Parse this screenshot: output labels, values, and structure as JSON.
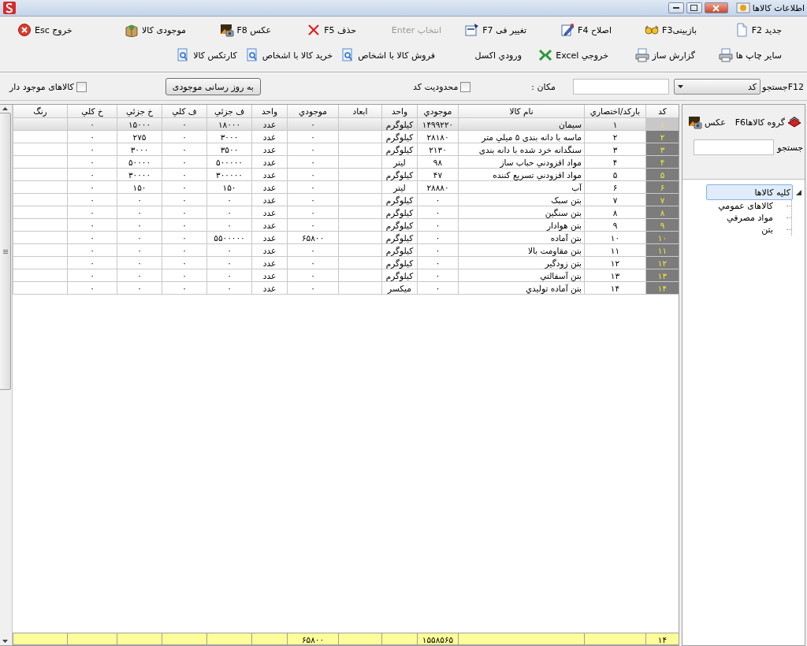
{
  "window": {
    "title": "اطلاعات کالاها"
  },
  "toolbar": {
    "row_1": [
      {
        "label": "جدید F2",
        "disabled": false
      },
      {
        "label": "بازبینیF3",
        "disabled": false
      },
      {
        "label": "اصلاح F4",
        "disabled": false
      },
      {
        "label": "تغییر فی F7",
        "disabled": false
      },
      {
        "label": "انتخاب Enter",
        "disabled": true
      },
      {
        "label": "حذف F5",
        "disabled": false
      },
      {
        "label": "عکس F8",
        "disabled": false
      },
      {
        "label": "موجودی کالا",
        "disabled": false
      }
    ],
    "row_2": [
      {
        "label": "سایر چاپ ها"
      },
      {
        "label": "گزارش ساز"
      },
      {
        "label": "خروجي Excel"
      },
      {
        "label": "ورودي اکسل"
      },
      {
        "label": "فروش کالا با اشخاص"
      },
      {
        "label": "خرید کالا با اشخاص"
      },
      {
        "label": "کارتکس کالا"
      }
    ],
    "exit_button": {
      "label": "خروج Esc"
    }
  },
  "filter": {
    "search_label": "F12جستجو",
    "search_by": {
      "value": "کد"
    },
    "location_label": "مکان :",
    "code_limit": {
      "label": "محدودیت کد",
      "checked": false
    },
    "update_button": {
      "label": "به روز رسانی موجودی"
    },
    "in_stock_only": {
      "label": "کالاهای موجود دار",
      "checked": false
    }
  },
  "table": {
    "columns": [
      "کد",
      "بارکد/اختصاري",
      "نام کالا",
      "موجودي",
      "واحد",
      "ابعاد",
      "موجودي",
      "واحد",
      "ف جزئي",
      "ف کلي",
      "خ جزئي",
      "خ کلي",
      "رنگ"
    ],
    "rows": [
      {
        "selected": true,
        "cells": [
          "۱",
          "۱",
          "سیمان",
          "۱۴۹۹۲۲۰",
          "کیلوگرم",
          null,
          "۰",
          "عدد",
          "۱۸۰۰۰",
          "۰",
          "۱۵۰۰۰",
          "۰",
          null
        ]
      },
      {
        "selected": false,
        "cells": [
          "۲",
          "۲",
          "ماسه با دانه بندی ۵ میلي متر",
          "۲۸۱۸۰",
          "کیلوگرم",
          null,
          "۰",
          "عدد",
          "۳۰۰۰",
          "۰",
          "۲۷۵",
          "۰",
          null
        ]
      },
      {
        "selected": false,
        "cells": [
          "۳",
          "۳",
          "سنگدانه خرد شده با دانه بندی",
          "۲۱۳۰",
          "کیلوگرم",
          null,
          "۰",
          "عدد",
          "۳۵۰۰",
          "۰",
          "۳۰۰۰",
          "۰",
          null
        ]
      },
      {
        "selected": false,
        "cells": [
          "۴",
          "۴",
          "مواد افزودني حباب ساز",
          "۹۸",
          "لیتر",
          null,
          "۰",
          "عدد",
          "۵۰۰۰۰۰",
          "۰",
          "۵۰۰۰۰",
          "۰",
          null
        ]
      },
      {
        "selected": false,
        "cells": [
          "۵",
          "۵",
          "مواد افزودني تسريع کننده",
          "۴۷",
          "کیلوگرم",
          null,
          "۰",
          "عدد",
          "۳۰۰۰۰۰",
          "۰",
          "۳۰۰۰۰",
          "۰",
          null
        ]
      },
      {
        "selected": false,
        "cells": [
          "۶",
          "۶",
          "آب",
          "۲۸۸۸۰",
          "لیتر",
          null,
          "۰",
          "عدد",
          "۱۵۰",
          "۰",
          "۱۵۰",
          "۰",
          null
        ]
      },
      {
        "selected": false,
        "cells": [
          "۷",
          "۷",
          "بتن سبک",
          "۰",
          "کیلوگرم",
          null,
          "۰",
          "عدد",
          "۰",
          "۰",
          "۰",
          "۰",
          null
        ]
      },
      {
        "selected": false,
        "cells": [
          "۸",
          "۸",
          "بتن سنگين",
          "۰",
          "کیلوگرم",
          null,
          "۰",
          "عدد",
          "۰",
          "۰",
          "۰",
          "۰",
          null
        ]
      },
      {
        "selected": false,
        "cells": [
          "۹",
          "۹",
          "بتن هوادار",
          "۰",
          "کیلوگرم",
          null,
          "۰",
          "عدد",
          "۰",
          "۰",
          "۰",
          "۰",
          null
        ]
      },
      {
        "selected": false,
        "cells": [
          "۱۰",
          "۱۰",
          "بتن آماده",
          "۰",
          "کیلوگرم",
          null,
          "۶۵۸۰۰",
          "عدد",
          "۵۵۰۰۰۰۰",
          "۰",
          "۰",
          "۰",
          null
        ]
      },
      {
        "selected": false,
        "cells": [
          "۱۱",
          "۱۱",
          "بتن مقاومت بالا",
          "۰",
          "کیلوگرم",
          null,
          "۰",
          "عدد",
          "۰",
          "۰",
          "۰",
          "۰",
          null
        ]
      },
      {
        "selected": false,
        "cells": [
          "۱۲",
          "۱۲",
          "بتن زودگير",
          "۰",
          "کیلوگرم",
          null,
          "۰",
          "عدد",
          "۰",
          "۰",
          "۰",
          "۰",
          null
        ]
      },
      {
        "selected": false,
        "cells": [
          "۱۳",
          "۱۳",
          "بتن آسفالتي",
          "۰",
          "کیلوگرم",
          null,
          "۰",
          "عدد",
          "۰",
          "۰",
          "۰",
          "۰",
          null
        ]
      },
      {
        "selected": false,
        "cells": [
          "۱۴",
          "۱۴",
          "بتن آماده توليدي",
          "۰",
          "میکسر",
          null,
          "۰",
          "عدد",
          "۰",
          "۰",
          "۰",
          "۰",
          null
        ]
      }
    ],
    "totals": {
      "code": "۱۴",
      "stock": "۱۵۵۸۵۶۵",
      "stock_2": "۶۵۸۰۰"
    }
  },
  "side_panel": {
    "group_button": {
      "label": "گروه کالاهاF6"
    },
    "photo_button": {
      "label": "عکس"
    },
    "search_label": "جستجو",
    "tree": [
      {
        "label": "کلیه کالاها",
        "selected": true,
        "expanded": true,
        "children": [
          {
            "label": "کالاهای عمومي",
            "selected": false
          },
          {
            "label": "مواد مصرفي",
            "selected": false
          },
          {
            "label": "بتن",
            "selected": false
          }
        ]
      }
    ]
  }
}
